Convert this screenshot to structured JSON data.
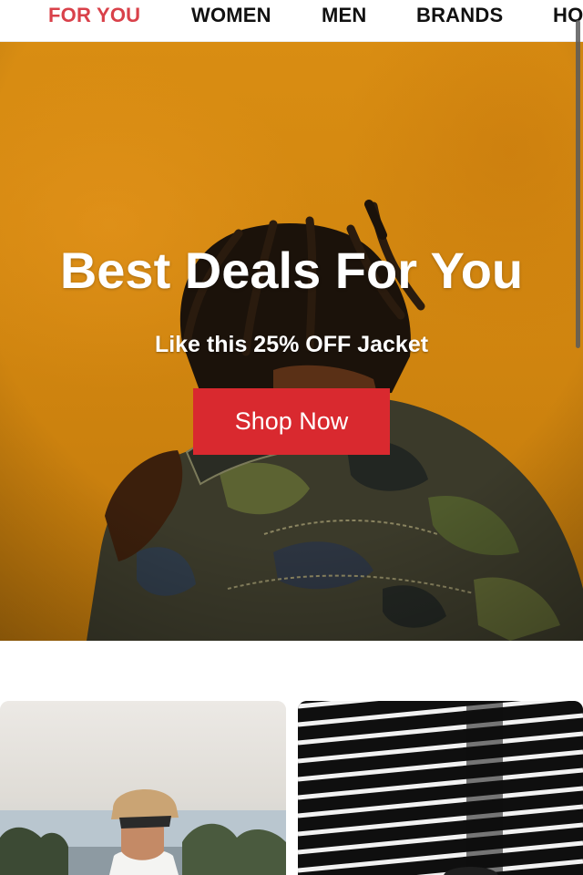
{
  "nav": {
    "tabs": [
      {
        "label": "FOR YOU",
        "active": true
      },
      {
        "label": "WOMEN",
        "active": false
      },
      {
        "label": "MEN",
        "active": false
      },
      {
        "label": "BRANDS",
        "active": false
      },
      {
        "label": "HO",
        "active": false
      }
    ]
  },
  "hero": {
    "title": "Best Deals For You",
    "subtitle": "Like this 25% OFF Jacket",
    "cta_label": "Shop Now"
  },
  "colors": {
    "active_tab": "#d9414a",
    "cta": "#d9292f",
    "hero_background": "#d4870e"
  },
  "cards": [
    {
      "image": "man-in-cap-photo"
    },
    {
      "image": "striped-architecture-photo"
    }
  ]
}
